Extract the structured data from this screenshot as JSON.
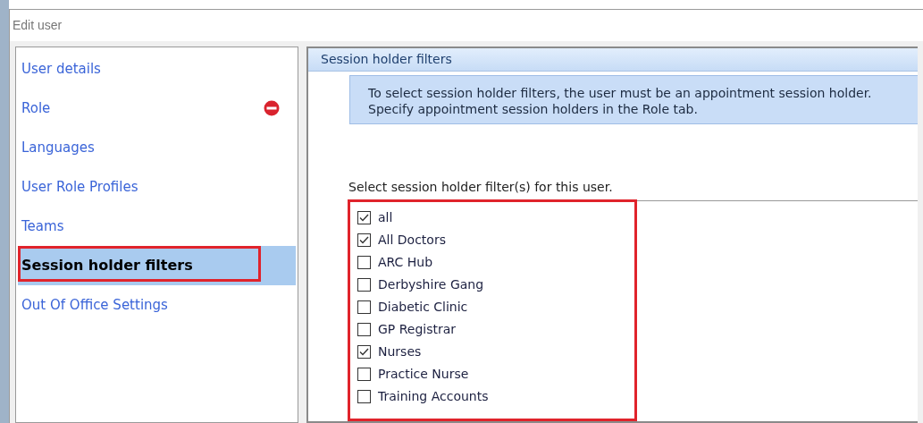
{
  "window": {
    "title": "Edit user"
  },
  "sidebar": {
    "items": [
      {
        "label": "User details",
        "selected": false,
        "error": false
      },
      {
        "label": "Role",
        "selected": false,
        "error": true
      },
      {
        "label": "Languages",
        "selected": false,
        "error": false
      },
      {
        "label": "User Role Profiles",
        "selected": false,
        "error": false
      },
      {
        "label": "Teams",
        "selected": false,
        "error": false
      },
      {
        "label": "Session holder filters",
        "selected": true,
        "error": false
      },
      {
        "label": "Out Of Office Settings",
        "selected": false,
        "error": false
      }
    ]
  },
  "panel": {
    "header": "Session holder filters",
    "info": [
      "To select session holder filters, the user must be an appointment session holder.",
      "Specify appointment session holders in the Role tab."
    ],
    "list_label": "Select session holder filter(s) for this user.",
    "filters": [
      {
        "label": "all",
        "checked": true
      },
      {
        "label": "All Doctors",
        "checked": true
      },
      {
        "label": "ARC Hub",
        "checked": false
      },
      {
        "label": "Derbyshire Gang",
        "checked": false
      },
      {
        "label": "Diabetic Clinic",
        "checked": false
      },
      {
        "label": "GP Registrar",
        "checked": false
      },
      {
        "label": "Nurses",
        "checked": true
      },
      {
        "label": "Practice Nurse",
        "checked": false
      },
      {
        "label": "Training Accounts",
        "checked": false
      }
    ]
  }
}
